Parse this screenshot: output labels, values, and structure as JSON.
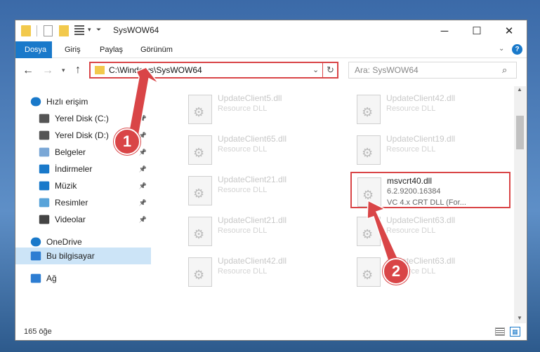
{
  "window": {
    "title": "SysWOW64"
  },
  "ribbon": {
    "tabs": [
      "Dosya",
      "Giriş",
      "Paylaş",
      "Görünüm"
    ],
    "active": 0
  },
  "address": {
    "path": "C:\\Windows\\SysWOW64"
  },
  "search": {
    "placeholder": "Ara: SysWOW64"
  },
  "nav": {
    "items": [
      {
        "label": "Hızlı erişim",
        "icon": "star-icon",
        "indent": 0,
        "pinned": false
      },
      {
        "label": "Yerel Disk (C:)",
        "icon": "drive-icon",
        "indent": 1,
        "pinned": true
      },
      {
        "label": "Yerel Disk (D:)",
        "icon": "drive-icon",
        "indent": 1,
        "pinned": true
      },
      {
        "label": "Belgeler",
        "icon": "documents-icon",
        "indent": 1,
        "pinned": true
      },
      {
        "label": "İndirmeler",
        "icon": "download-icon",
        "indent": 1,
        "pinned": true
      },
      {
        "label": "Müzik",
        "icon": "music-icon",
        "indent": 1,
        "pinned": true
      },
      {
        "label": "Resimler",
        "icon": "pictures-icon",
        "indent": 1,
        "pinned": true
      },
      {
        "label": "Videolar",
        "icon": "videos-icon",
        "indent": 1,
        "pinned": true
      },
      {
        "label": "OneDrive",
        "icon": "cloud-icon",
        "indent": 0,
        "pinned": false
      },
      {
        "label": "Bu bilgisayar",
        "icon": "computer-icon",
        "indent": 0,
        "pinned": false,
        "selected": true
      },
      {
        "label": "Ağ",
        "icon": "network-icon",
        "indent": 0,
        "pinned": false
      }
    ]
  },
  "files": [
    {
      "name": "UpdateClient5.dll",
      "desc": "Resource DLL",
      "type": ""
    },
    {
      "name": "UpdateClient42.dll",
      "desc": "Resource DLL",
      "type": ""
    },
    {
      "name": "UpdateClient65.dll",
      "desc": "Resource DLL",
      "type": ""
    },
    {
      "name": "UpdateClient19.dll",
      "desc": "Resource DLL",
      "type": ""
    },
    {
      "name": "UpdateClient21.dll",
      "desc": "Resource DLL",
      "type": ""
    },
    {
      "name": "msvcrt40.dll",
      "desc": "6.2.9200.16384",
      "type": "VC 4.x CRT DLL (For...",
      "highlighted": true
    },
    {
      "name": "UpdateClient21.dll",
      "desc": "Resource DLL",
      "type": ""
    },
    {
      "name": "UpdateClient63.dll",
      "desc": "Resource DLL",
      "type": ""
    },
    {
      "name": "UpdateClient42.dll",
      "desc": "Resource DLL",
      "type": ""
    },
    {
      "name": "UpdateClient63.dll",
      "desc": "Resource DLL",
      "type": ""
    }
  ],
  "status": {
    "count": "165 öğe"
  },
  "annotations": {
    "step1": "1",
    "step2": "2",
    "color": "#d94547"
  }
}
